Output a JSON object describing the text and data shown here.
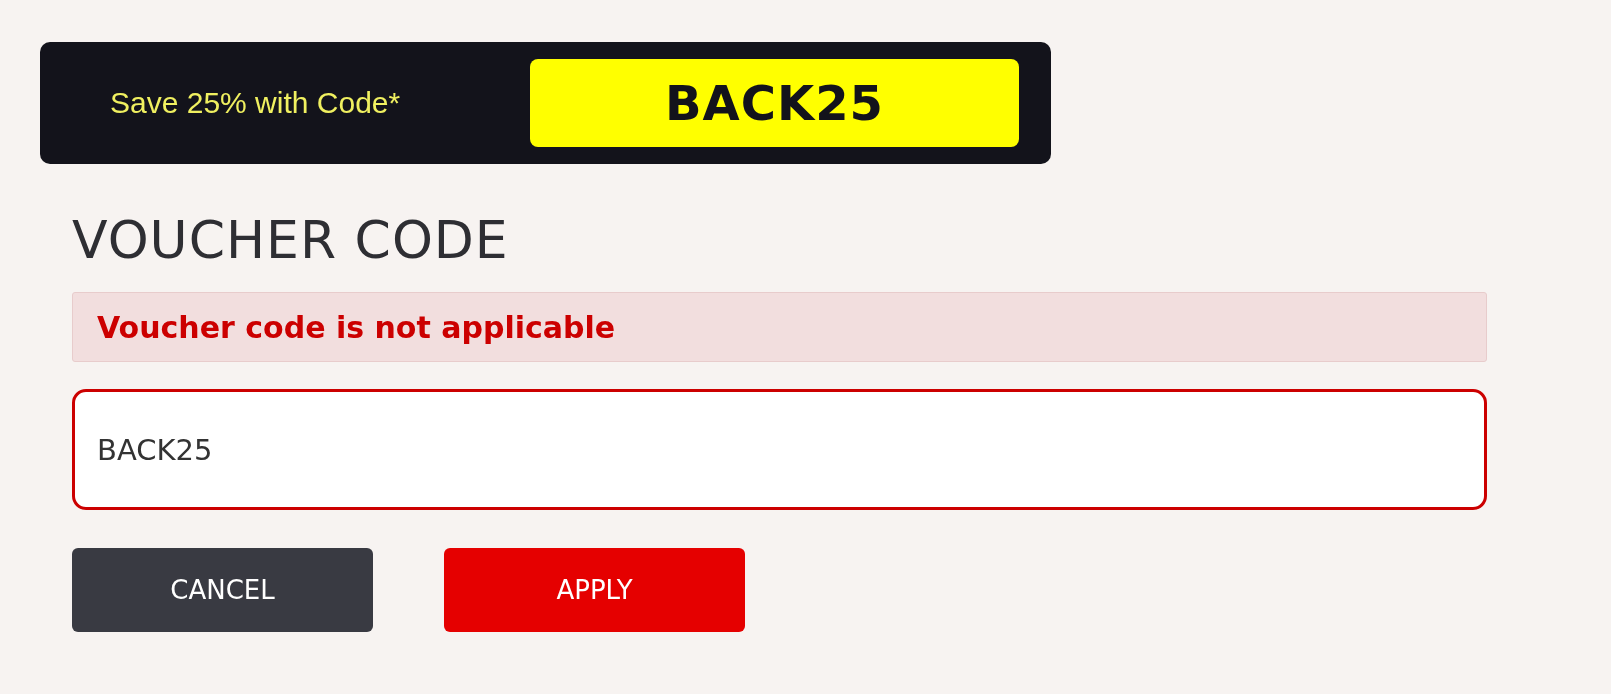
{
  "promo_banner": {
    "text": "Save 25% with Code*",
    "code": "BACK25"
  },
  "heading": "VOUCHER CODE",
  "error_message": "Voucher code is not applicable",
  "voucher_field": {
    "value": "BACK25",
    "invalid": true
  },
  "buttons": [
    {
      "label": "CANCEL",
      "kind": "secondary"
    },
    {
      "label": "APPLY",
      "kind": "primary"
    }
  ]
}
